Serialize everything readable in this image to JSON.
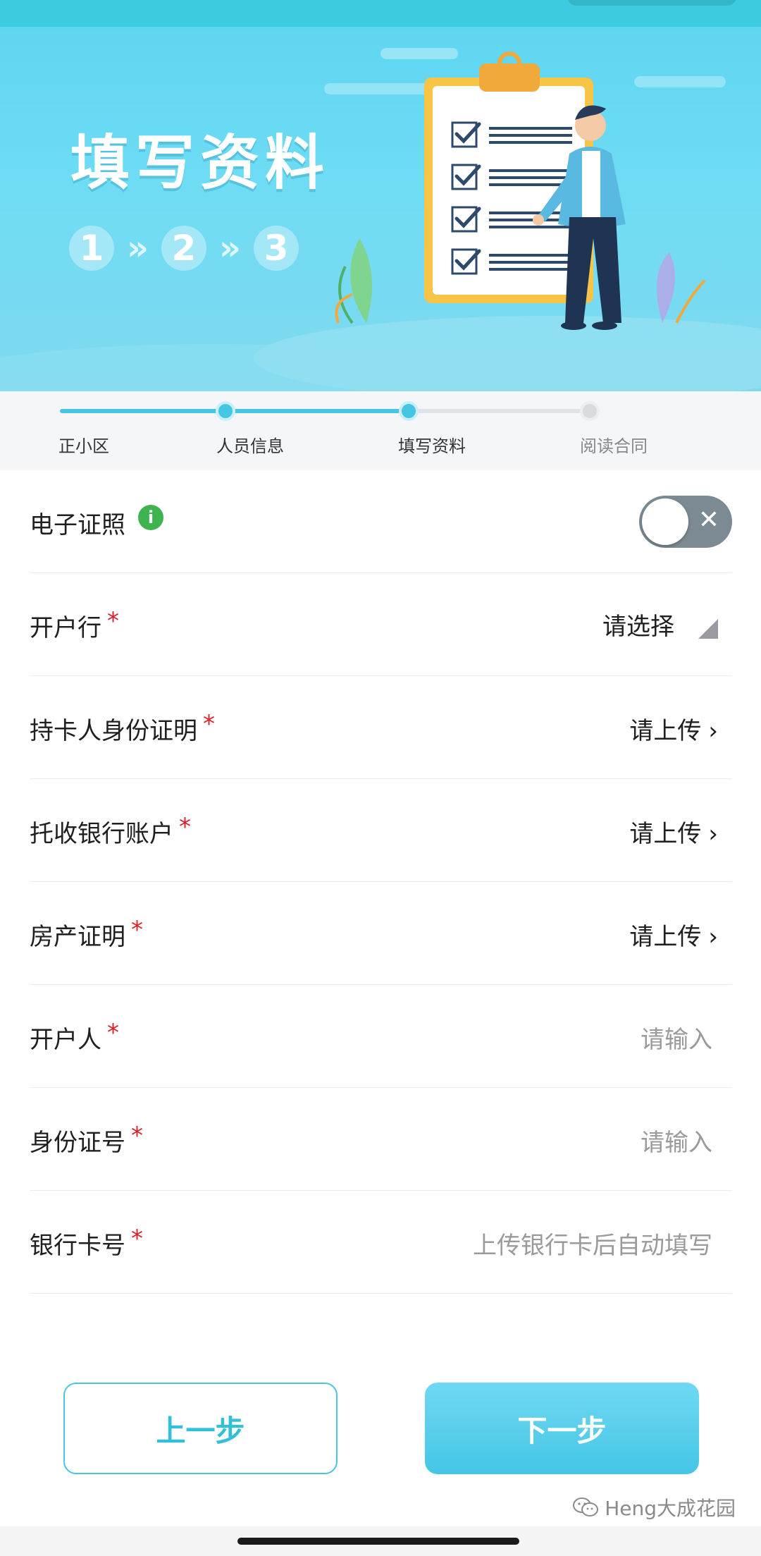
{
  "hero": {
    "title": "填写资料",
    "steps": [
      "1",
      "2",
      "3"
    ],
    "arrow": "»"
  },
  "progress": {
    "steps": [
      {
        "label": "正小区",
        "state": "done"
      },
      {
        "label": "人员信息",
        "state": "done"
      },
      {
        "label": "填写资料",
        "state": "current"
      },
      {
        "label": "阅读合同",
        "state": "todo"
      }
    ]
  },
  "form": {
    "e_license": {
      "label": "电子证照",
      "info_icon": "i",
      "toggle_on": false,
      "toggle_icon": "✕"
    },
    "bank": {
      "label": "开户行",
      "required_mark": "*",
      "value": "请选择"
    },
    "holder_id": {
      "label": "持卡人身份证明",
      "required_mark": "*",
      "value": "请上传",
      "chevron": "›"
    },
    "collection_account": {
      "label": "托收银行账户",
      "required_mark": "*",
      "value": "请上传",
      "chevron": "›"
    },
    "property_proof": {
      "label": "房产证明",
      "required_mark": "*",
      "value": "请上传",
      "chevron": "›"
    },
    "account_holder": {
      "label": "开户人",
      "required_mark": "*",
      "placeholder": "请输入"
    },
    "id_number": {
      "label": "身份证号",
      "required_mark": "*",
      "placeholder": "请输入"
    },
    "card_number": {
      "label": "银行卡号",
      "required_mark": "*",
      "placeholder": "上传银行卡后自动填写"
    }
  },
  "buttons": {
    "prev": "上一步",
    "next": "下一步"
  },
  "watermark": {
    "text": "Heng大成花园",
    "icon": "wechat-icon"
  },
  "colors": {
    "accent": "#47c6e3",
    "required": "#d8202a",
    "info": "#3fb34f"
  }
}
